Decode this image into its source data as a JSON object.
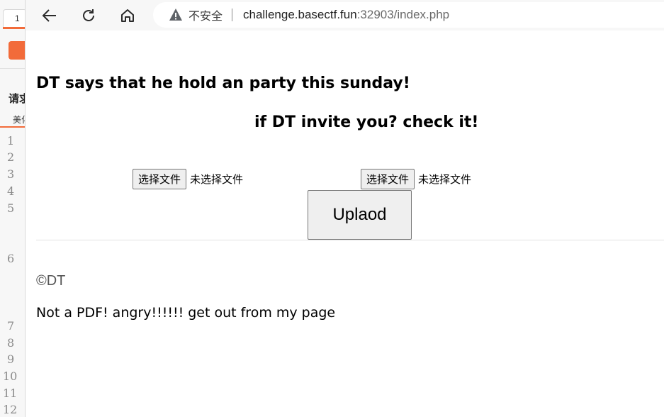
{
  "background_app": {
    "tab_label": "1",
    "heading": "请求",
    "subtab": "美化",
    "line_numbers": [
      "1",
      "2",
      "3",
      "4",
      "5",
      "6",
      "7",
      "8",
      "9",
      "10",
      "11",
      "12"
    ]
  },
  "browser": {
    "security_label": "不安全",
    "url_host": "challenge.basectf.fun",
    "url_rest": ":32903/index.php"
  },
  "page": {
    "heading": "DT says that he hold an party this sunday!",
    "subheading": "if DT invite you? check it!",
    "file_inputs": [
      {
        "button_label": "选择文件",
        "status": "未选择文件"
      },
      {
        "button_label": "选择文件",
        "status": "未选择文件"
      }
    ],
    "upload_label": "Uplaod",
    "copyright": "©DT",
    "message": "Not a PDF! angry!!!!!! get out from my page"
  },
  "colors": {
    "accent_orange": "#f26b3a",
    "warning_icon": "#5f6368"
  }
}
